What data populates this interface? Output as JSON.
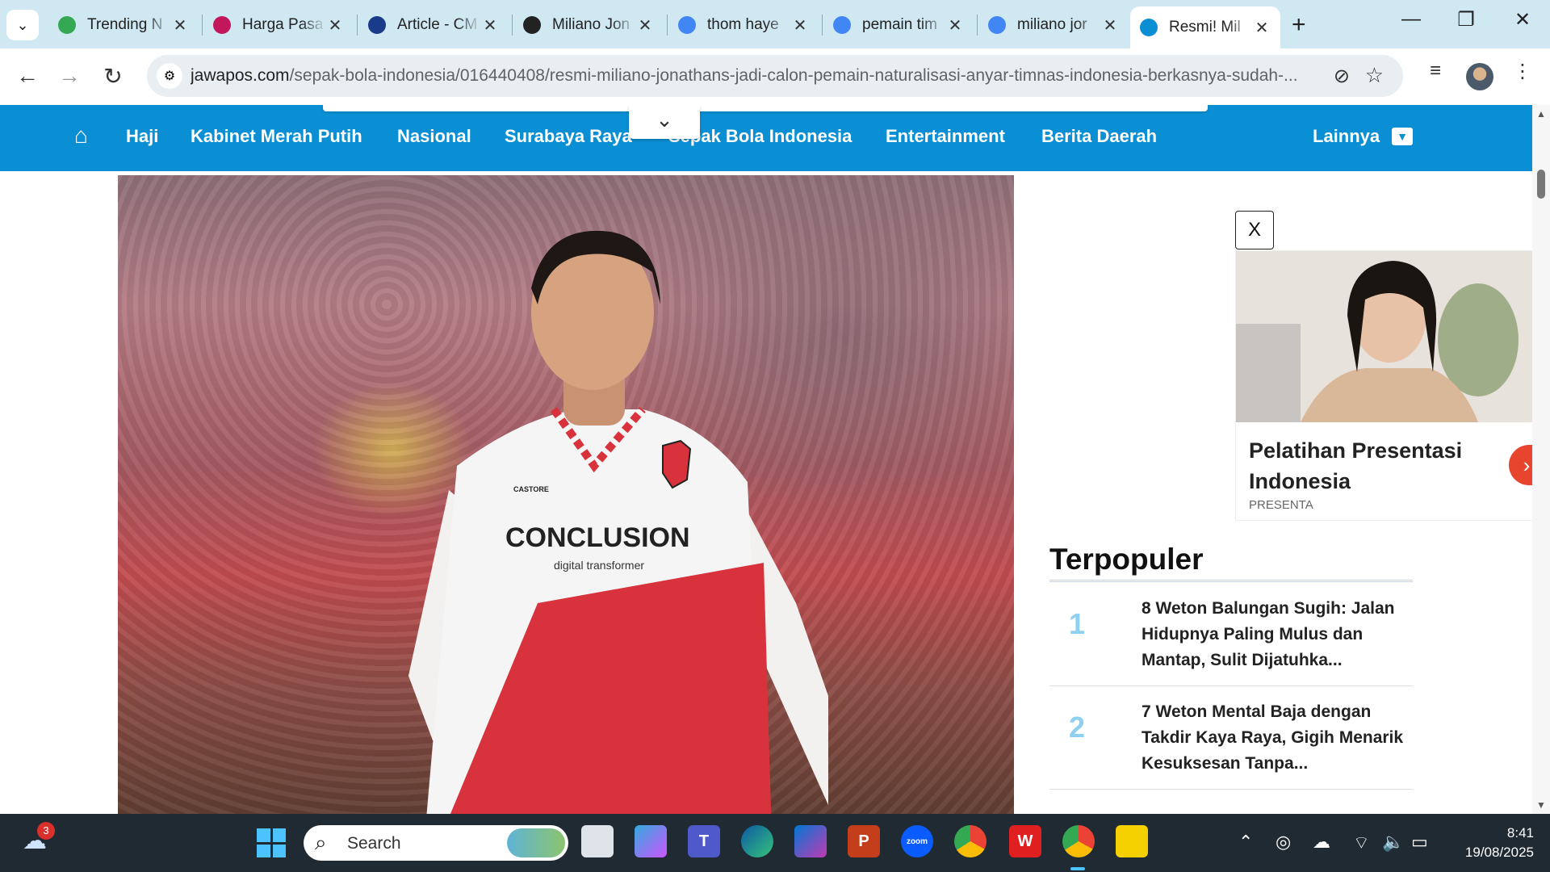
{
  "browser": {
    "tabs": [
      {
        "title": "Trending N",
        "icon": "trending-icon",
        "color": "#34a853"
      },
      {
        "title": "Harga Pasa",
        "icon": "s-icon",
        "color": "#c2185b"
      },
      {
        "title": "Article - CM",
        "icon": "ro-icon",
        "color": "#1a3a8a"
      },
      {
        "title": "Miliano Jon",
        "icon": "chatgpt-icon",
        "color": "#222222"
      },
      {
        "title": "thom haye",
        "icon": "google-icon",
        "color": "#4285f4"
      },
      {
        "title": "pemain tim",
        "icon": "google-icon",
        "color": "#4285f4"
      },
      {
        "title": "miliano jor",
        "icon": "google-icon",
        "color": "#4285f4"
      },
      {
        "title": "Resmi! Mil",
        "icon": "jp-icon",
        "color": "#0a8fd4",
        "active": true
      }
    ],
    "url_domain": "jawapos.com",
    "url_path": "/sepak-bola-indonesia/016440408/resmi-miliano-jonathans-jadi-calon-pemain-naturalisasi-anyar-timnas-indonesia-berkasnya-sudah-..."
  },
  "sitenav": {
    "items": [
      "Haji",
      "Kabinet Merah Putih",
      "Nasional",
      "Surabaya Raya",
      "Sepak Bola Indonesia",
      "Entertainment",
      "Berita Daerah"
    ],
    "more": "Lainnya"
  },
  "hero": {
    "shirt_sponsor": "CONCLUSION",
    "shirt_sub": "digital transformer",
    "brand": "CASTORE"
  },
  "ad": {
    "close": "X",
    "title": "Pelatihan Presentasi Indonesia",
    "source": "PRESENTA"
  },
  "popular": {
    "title": "Terpopuler",
    "items": [
      {
        "num": "1",
        "text": "8 Weton Balungan Sugih: Jalan Hidupnya Paling Mulus dan Mantap, Sulit Dijatuhka..."
      },
      {
        "num": "2",
        "text": "7 Weton Mental Baja dengan Takdir Kaya Raya, Gigih Menarik Kesuksesan Tanpa..."
      }
    ]
  },
  "taskbar": {
    "weather_badge": "3",
    "search_label": "Search",
    "time": "8:41",
    "date": "19/08/2025"
  }
}
